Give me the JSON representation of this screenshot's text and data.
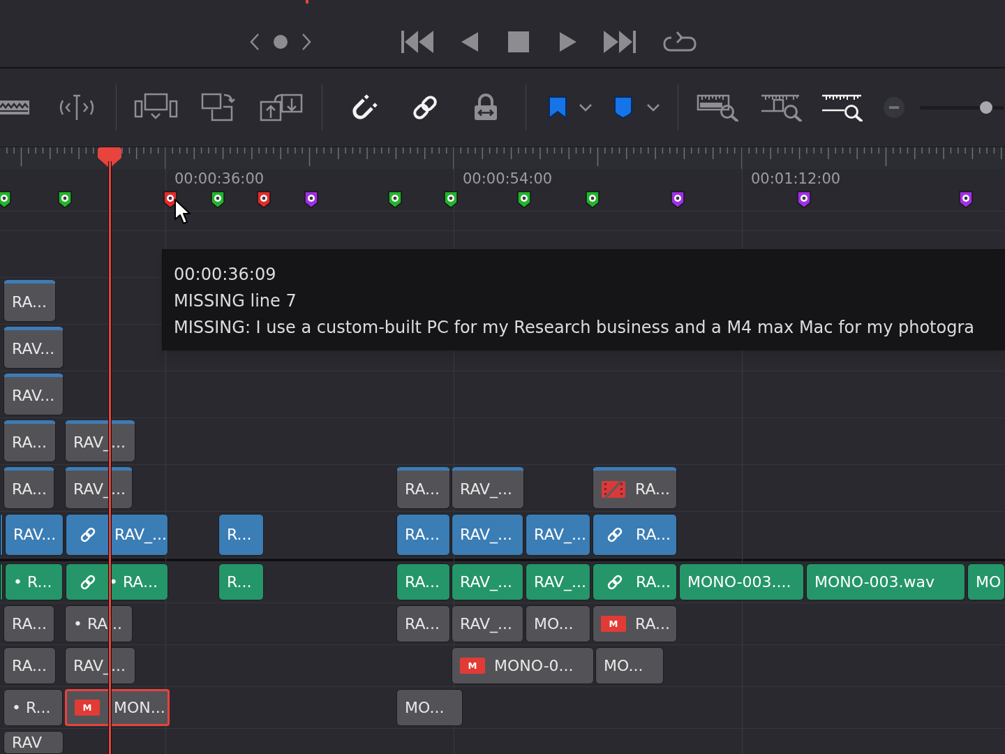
{
  "toolbar": {
    "snapping": {
      "on": true
    },
    "linked_selection": {
      "on": true
    },
    "position_lock": {
      "on": false
    },
    "zoom_modes": [
      {
        "kind": "full",
        "selected": false
      },
      {
        "kind": "detail",
        "selected": false
      },
      {
        "kind": "custom",
        "selected": true
      }
    ],
    "zoom_slider": {
      "level": 0.79
    }
  },
  "ruler": {
    "timecodes": [
      "00:00:36:00",
      "00:00:54:00",
      "00:01:12:00"
    ]
  },
  "markers": [
    {
      "color": "#22b52c"
    },
    {
      "color": "#22b52c"
    },
    {
      "color": "#e52b2b"
    },
    {
      "color": "#22b52c"
    },
    {
      "color": "#e52b2b"
    },
    {
      "color": "#a22fe6"
    },
    {
      "color": "#22b52c"
    },
    {
      "color": "#22b52c"
    },
    {
      "color": "#22b52c"
    },
    {
      "color": "#22b52c"
    },
    {
      "color": "#a22fe6"
    },
    {
      "color": "#a22fe6"
    },
    {
      "color": "#a22fe6"
    }
  ],
  "marker_tooltip": {
    "lines": [
      "00:00:36:09",
      "MISSING line 7",
      "MISSING: I use a custom-built PC for my Research business and a M4 max Mac for my photogra"
    ]
  },
  "tracks": [
    {
      "kind": "video",
      "enabled": false,
      "clips": [
        {
          "label": "RA...",
          "selected": false,
          "linked": false,
          "offline": false
        }
      ]
    },
    {
      "kind": "video",
      "enabled": false,
      "clips": [
        {
          "label": "RAV...",
          "selected": false,
          "linked": false,
          "offline": false
        }
      ]
    },
    {
      "kind": "video",
      "enabled": false,
      "clips": [
        {
          "label": "RAV...",
          "selected": false,
          "linked": false,
          "offline": false
        }
      ]
    },
    {
      "kind": "video",
      "enabled": false,
      "clips": [
        {
          "label": "RA...",
          "selected": false,
          "linked": false,
          "offline": false
        },
        {
          "label": "RAV_...",
          "selected": false,
          "linked": false,
          "offline": false
        }
      ]
    },
    {
      "kind": "video",
      "enabled": false,
      "clips": [
        {
          "label": "RA...",
          "selected": false,
          "linked": false,
          "offline": false
        },
        {
          "label": "RAV_...",
          "selected": false,
          "linked": false,
          "offline": false
        },
        {
          "label": "RA...",
          "selected": false,
          "linked": false,
          "offline": false
        },
        {
          "label": "RAV_...",
          "selected": false,
          "linked": false,
          "offline": false
        },
        {
          "label": "RA...",
          "selected": false,
          "linked": false,
          "offline": true
        }
      ]
    },
    {
      "kind": "video",
      "enabled": true,
      "clips": [
        {
          "selected": false,
          "linked": false,
          "offline": false
        },
        {
          "label": "RAV...",
          "selected": false,
          "linked": false,
          "offline": false
        },
        {
          "label": "RAV_...",
          "selected": false,
          "linked": true,
          "offline": false
        },
        {
          "label": "R...",
          "selected": false,
          "linked": false,
          "offline": false
        },
        {
          "label": "RA...",
          "selected": false,
          "linked": false,
          "offline": false
        },
        {
          "label": "RAV_...",
          "selected": false,
          "linked": false,
          "offline": false
        },
        {
          "label": "RAV_...",
          "selected": false,
          "linked": false,
          "offline": false
        },
        {
          "label": "RA...",
          "selected": false,
          "linked": true,
          "offline": false
        }
      ]
    },
    {
      "kind": "audio",
      "enabled": true,
      "clips": [
        {
          "selected": false,
          "linked": false,
          "offline": false
        },
        {
          "label": "• R...",
          "selected": false,
          "linked": false,
          "offline": false
        },
        {
          "label": "• RA...",
          "selected": false,
          "linked": true,
          "offline": false
        },
        {
          "label": "R...",
          "selected": false,
          "linked": false,
          "offline": false
        },
        {
          "label": "RA...",
          "selected": false,
          "linked": false,
          "offline": false
        },
        {
          "label": "RAV_...",
          "selected": false,
          "linked": false,
          "offline": false
        },
        {
          "label": "RAV_...",
          "selected": false,
          "linked": false,
          "offline": false
        },
        {
          "label": "RA...",
          "selected": false,
          "linked": true,
          "offline": false
        },
        {
          "label": "MONO-003....",
          "selected": false,
          "linked": false,
          "offline": false
        },
        {
          "label": "MONO-003.wav",
          "selected": false,
          "linked": false,
          "offline": false
        },
        {
          "label": "MO",
          "selected": false,
          "linked": false,
          "offline": false
        }
      ]
    },
    {
      "kind": "audio",
      "enabled": false,
      "clips": [
        {
          "label": "RA...",
          "selected": false,
          "linked": false,
          "offline": false
        },
        {
          "label": "• RA...",
          "selected": false,
          "linked": false,
          "offline": false
        },
        {
          "label": "RA...",
          "selected": false,
          "linked": false,
          "offline": false
        },
        {
          "label": "RAV_...",
          "selected": false,
          "linked": false,
          "offline": false
        },
        {
          "label": "MO...",
          "selected": false,
          "linked": false,
          "offline": false
        },
        {
          "label": "RA...",
          "badge": "M",
          "selected": false,
          "linked": false,
          "offline": false
        }
      ]
    },
    {
      "kind": "audio",
      "enabled": false,
      "clips": [
        {
          "label": "RA...",
          "selected": false,
          "linked": false,
          "offline": false
        },
        {
          "label": "RAV_...",
          "selected": false,
          "linked": false,
          "offline": false
        },
        {
          "label": "MONO-0...",
          "badge": "M",
          "selected": false,
          "linked": false,
          "offline": false
        },
        {
          "label": "MO...",
          "selected": false,
          "linked": false,
          "offline": false
        }
      ]
    },
    {
      "kind": "audio",
      "enabled": false,
      "clips": [
        {
          "label": "• R...",
          "selected": false,
          "linked": false,
          "offline": false
        },
        {
          "label": "MON...",
          "badge": "M",
          "selected": true,
          "linked": false,
          "offline": false
        },
        {
          "label": "MO...",
          "selected": false,
          "linked": false,
          "offline": false
        }
      ]
    },
    {
      "kind": "audio",
      "enabled": false,
      "clips": [
        {
          "label": "RAV",
          "selected": false,
          "linked": false,
          "offline": false
        }
      ]
    }
  ]
}
